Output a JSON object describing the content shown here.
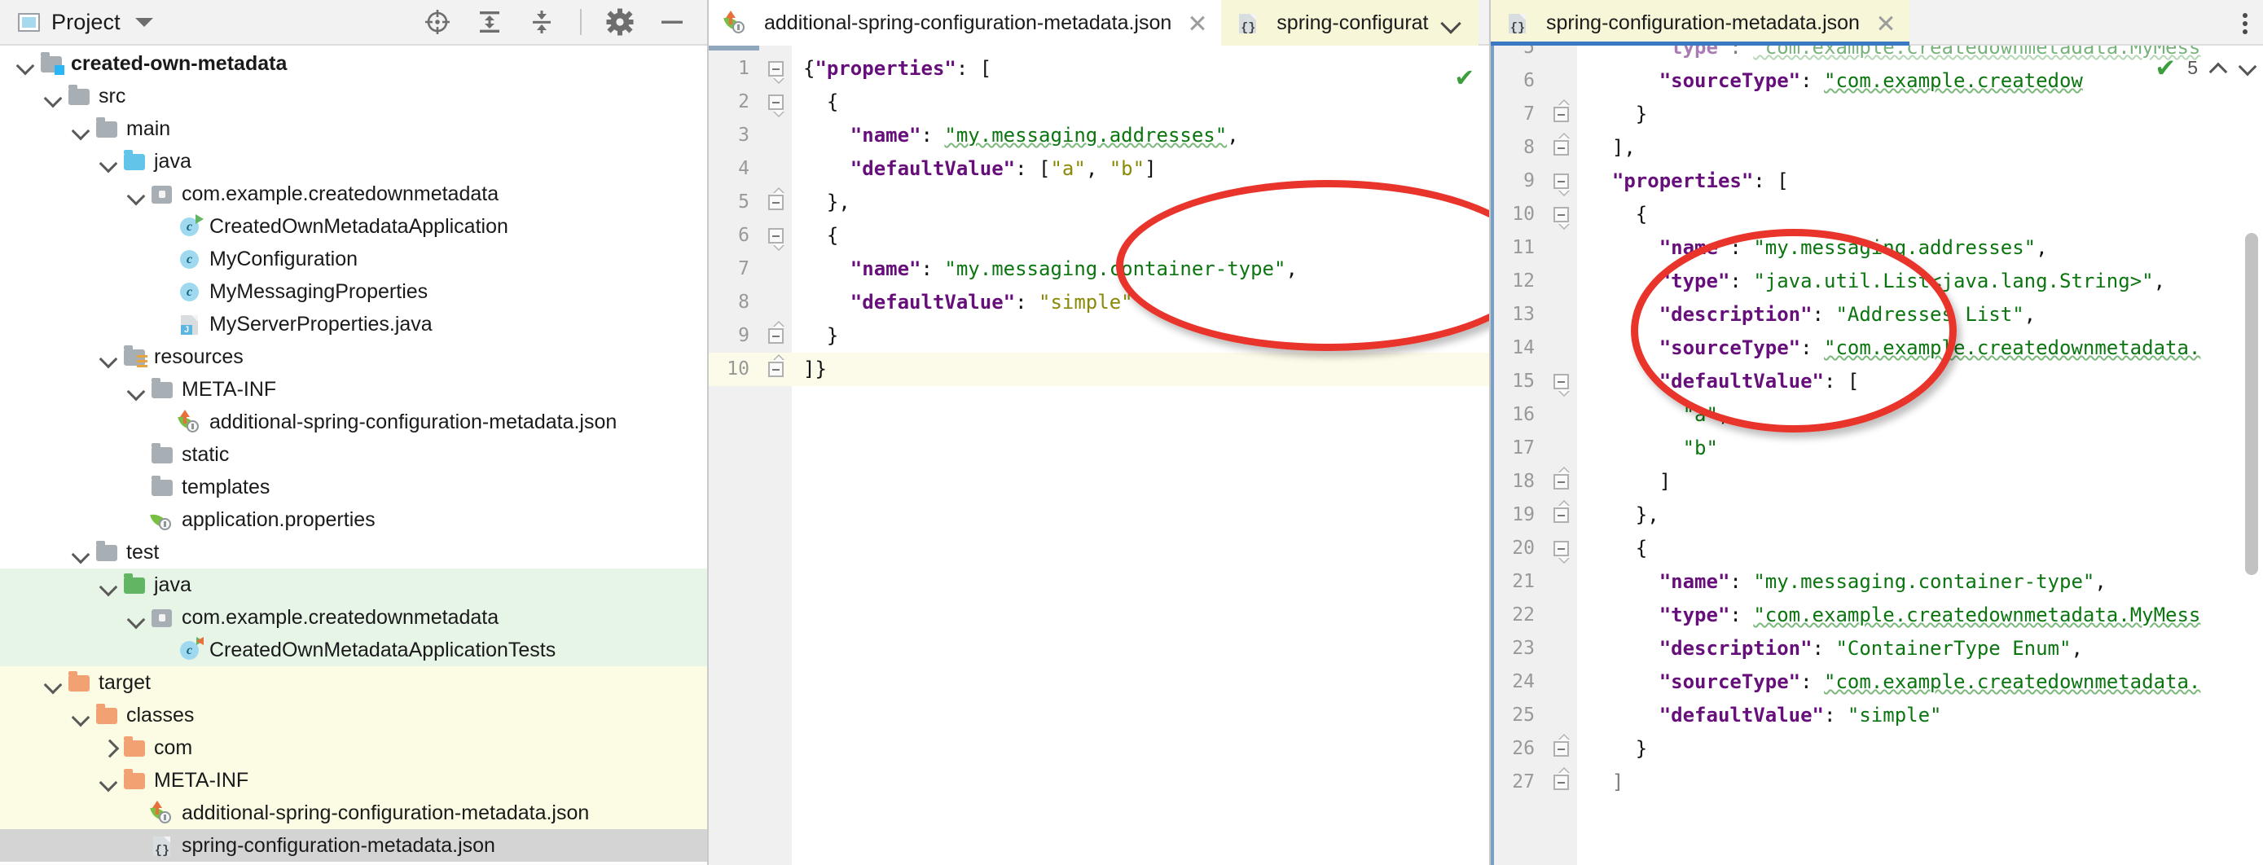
{
  "project_panel": {
    "title": "Project",
    "toolbar": [
      {
        "name": "select-opened-file-icon",
        "glyph": "target"
      },
      {
        "name": "expand-all-icon",
        "glyph": "expand"
      },
      {
        "name": "collapse-all-icon",
        "glyph": "collapse"
      },
      {
        "name": "settings-gear-icon",
        "glyph": "gear"
      },
      {
        "name": "hide-icon",
        "glyph": "minus"
      }
    ],
    "tree": [
      {
        "label": "created-own-metadata",
        "depth": 0,
        "arrow": "down",
        "icon": "module-folder",
        "bold": true,
        "bg": "none"
      },
      {
        "label": "src",
        "depth": 1,
        "arrow": "down",
        "icon": "folder-gray",
        "bold": false,
        "bg": "none"
      },
      {
        "label": "main",
        "depth": 2,
        "arrow": "down",
        "icon": "folder-gray",
        "bold": false,
        "bg": "none"
      },
      {
        "label": "java",
        "depth": 3,
        "arrow": "down",
        "icon": "folder-blue",
        "bold": false,
        "bg": "none"
      },
      {
        "label": "com.example.createdownmetadata",
        "depth": 4,
        "arrow": "down",
        "icon": "package",
        "bold": false,
        "bg": "none"
      },
      {
        "label": "CreatedOwnMetadataApplication",
        "depth": 5,
        "arrow": "none",
        "icon": "class-run",
        "bold": false,
        "bg": "none"
      },
      {
        "label": "MyConfiguration",
        "depth": 5,
        "arrow": "none",
        "icon": "class",
        "bold": false,
        "bg": "none"
      },
      {
        "label": "MyMessagingProperties",
        "depth": 5,
        "arrow": "none",
        "icon": "class",
        "bold": false,
        "bg": "none"
      },
      {
        "label": "MyServerProperties.java",
        "depth": 5,
        "arrow": "none",
        "icon": "java-file",
        "bold": false,
        "bg": "none"
      },
      {
        "label": "resources",
        "depth": 3,
        "arrow": "down",
        "icon": "folder-resources",
        "bold": false,
        "bg": "none"
      },
      {
        "label": "META-INF",
        "depth": 4,
        "arrow": "down",
        "icon": "folder-gray",
        "bold": false,
        "bg": "none"
      },
      {
        "label": "additional-spring-configuration-metadata.json",
        "depth": 5,
        "arrow": "none",
        "icon": "spring-additional",
        "bold": false,
        "bg": "none"
      },
      {
        "label": "static",
        "depth": 4,
        "arrow": "none",
        "icon": "folder-gray",
        "bold": false,
        "bg": "none"
      },
      {
        "label": "templates",
        "depth": 4,
        "arrow": "none",
        "icon": "folder-gray",
        "bold": false,
        "bg": "none"
      },
      {
        "label": "application.properties",
        "depth": 4,
        "arrow": "none",
        "icon": "spring-properties",
        "bold": false,
        "bg": "none"
      },
      {
        "label": "test",
        "depth": 2,
        "arrow": "down",
        "icon": "folder-gray",
        "bold": false,
        "bg": "none"
      },
      {
        "label": "java",
        "depth": 3,
        "arrow": "down",
        "icon": "folder-green",
        "bold": false,
        "bg": "green"
      },
      {
        "label": "com.example.createdownmetadata",
        "depth": 4,
        "arrow": "down",
        "icon": "package",
        "bold": false,
        "bg": "green"
      },
      {
        "label": "CreatedOwnMetadataApplicationTests",
        "depth": 5,
        "arrow": "none",
        "icon": "class-test",
        "bold": false,
        "bg": "green"
      },
      {
        "label": "target",
        "depth": 1,
        "arrow": "down",
        "icon": "folder-orange",
        "bold": false,
        "bg": "yellow"
      },
      {
        "label": "classes",
        "depth": 2,
        "arrow": "down",
        "icon": "folder-orange",
        "bold": false,
        "bg": "yellow"
      },
      {
        "label": "com",
        "depth": 3,
        "arrow": "right",
        "icon": "folder-orange",
        "bold": false,
        "bg": "yellow"
      },
      {
        "label": "META-INF",
        "depth": 3,
        "arrow": "down",
        "icon": "folder-orange",
        "bold": false,
        "bg": "yellow"
      },
      {
        "label": "additional-spring-configuration-metadata.json",
        "depth": 4,
        "arrow": "none",
        "icon": "spring-additional",
        "bold": false,
        "bg": "yellow"
      },
      {
        "label": "spring-configuration-metadata.json",
        "depth": 4,
        "arrow": "none",
        "icon": "json-file",
        "bold": false,
        "bg": "selected"
      }
    ]
  },
  "left_editor": {
    "tabs": [
      {
        "label": "additional-spring-configuration-metadata.json",
        "icon": "spring-additional",
        "state": "active-white",
        "closable": true
      },
      {
        "label": "spring-configurat",
        "icon": "json-file",
        "state": "spring-bg",
        "closable": false
      }
    ],
    "has_chevron": true,
    "has_kebab": true,
    "inspection_ok": "✔",
    "lines": [
      {
        "no": "1",
        "fold": "open",
        "current": false,
        "tokens": [
          {
            "t": "{",
            "c": "pun"
          },
          {
            "t": "\"properties\"",
            "c": "key"
          },
          {
            "t": ": [",
            "c": "pun"
          }
        ]
      },
      {
        "no": "2",
        "fold": "open",
        "current": false,
        "tokens": [
          {
            "t": "  {",
            "c": "pun"
          }
        ]
      },
      {
        "no": "3",
        "fold": "none",
        "current": false,
        "tokens": [
          {
            "t": "    ",
            "c": "pun"
          },
          {
            "t": "\"name\"",
            "c": "key"
          },
          {
            "t": ": ",
            "c": "pun"
          },
          {
            "t": "\"my.messaging.addresses\"",
            "c": "str-wavy"
          },
          {
            "t": ",",
            "c": "pun"
          }
        ]
      },
      {
        "no": "4",
        "fold": "none",
        "current": false,
        "tokens": [
          {
            "t": "    ",
            "c": "pun"
          },
          {
            "t": "\"defaultValue\"",
            "c": "key"
          },
          {
            "t": ": [",
            "c": "pun"
          },
          {
            "t": "\"a\"",
            "c": "arr"
          },
          {
            "t": ", ",
            "c": "pun"
          },
          {
            "t": "\"b\"",
            "c": "arr"
          },
          {
            "t": "]",
            "c": "pun"
          }
        ]
      },
      {
        "no": "5",
        "fold": "close",
        "current": false,
        "tokens": [
          {
            "t": "  },",
            "c": "pun"
          }
        ]
      },
      {
        "no": "6",
        "fold": "open",
        "current": false,
        "tokens": [
          {
            "t": "  {",
            "c": "pun"
          }
        ]
      },
      {
        "no": "7",
        "fold": "none",
        "current": false,
        "tokens": [
          {
            "t": "    ",
            "c": "pun"
          },
          {
            "t": "\"name\"",
            "c": "key"
          },
          {
            "t": ": ",
            "c": "pun"
          },
          {
            "t": "\"my.messaging.container-type\"",
            "c": "str"
          },
          {
            "t": ",",
            "c": "pun"
          }
        ]
      },
      {
        "no": "8",
        "fold": "none",
        "current": false,
        "tokens": [
          {
            "t": "    ",
            "c": "pun"
          },
          {
            "t": "\"defaultValue\"",
            "c": "key"
          },
          {
            "t": ": ",
            "c": "pun"
          },
          {
            "t": "\"simple\"",
            "c": "arr"
          }
        ]
      },
      {
        "no": "9",
        "fold": "close",
        "current": false,
        "tokens": [
          {
            "t": "  }",
            "c": "pun"
          }
        ]
      },
      {
        "no": "10",
        "fold": "close",
        "current": true,
        "tokens": [
          {
            "t": "]}",
            "c": "pun"
          }
        ]
      }
    ]
  },
  "right_editor": {
    "tabs": [
      {
        "label": "spring-configuration-metadata.json",
        "icon": "json-file",
        "state": "spring-bg-selected",
        "closable": true
      }
    ],
    "has_kebab": true,
    "inspection": {
      "check": "✔",
      "count": "5",
      "up": "∧",
      "down": "∨"
    },
    "lines": [
      {
        "no": "5",
        "fold": "none",
        "clipped": true,
        "tokens": [
          {
            "t": "      ",
            "c": "pun"
          },
          {
            "t": "\"type\"",
            "c": "key"
          },
          {
            "t": ": ",
            "c": "pun"
          },
          {
            "t": "\"com.example.createdownmetadata.MyMess",
            "c": "str-wavy"
          }
        ]
      },
      {
        "no": "6",
        "fold": "none",
        "clipped": false,
        "tokens": [
          {
            "t": "      ",
            "c": "pun"
          },
          {
            "t": "\"sourceType\"",
            "c": "key"
          },
          {
            "t": ": ",
            "c": "pun"
          },
          {
            "t": "\"com.example.createdow",
            "c": "str-wavy"
          }
        ]
      },
      {
        "no": "7",
        "fold": "close",
        "clipped": false,
        "tokens": [
          {
            "t": "    }",
            "c": "pun"
          }
        ]
      },
      {
        "no": "8",
        "fold": "close",
        "clipped": false,
        "tokens": [
          {
            "t": "  ],",
            "c": "pun"
          }
        ]
      },
      {
        "no": "9",
        "fold": "open",
        "clipped": false,
        "tokens": [
          {
            "t": "  ",
            "c": "pun"
          },
          {
            "t": "\"properties\"",
            "c": "key"
          },
          {
            "t": ": [",
            "c": "pun"
          }
        ]
      },
      {
        "no": "10",
        "fold": "open",
        "clipped": false,
        "tokens": [
          {
            "t": "    {",
            "c": "pun"
          }
        ]
      },
      {
        "no": "11",
        "fold": "none",
        "clipped": false,
        "tokens": [
          {
            "t": "      ",
            "c": "pun"
          },
          {
            "t": "\"name\"",
            "c": "key"
          },
          {
            "t": ": ",
            "c": "pun"
          },
          {
            "t": "\"my.messaging.addresses\"",
            "c": "str"
          },
          {
            "t": ",",
            "c": "pun"
          }
        ]
      },
      {
        "no": "12",
        "fold": "none",
        "clipped": false,
        "tokens": [
          {
            "t": "      ",
            "c": "pun"
          },
          {
            "t": "\"type\"",
            "c": "key"
          },
          {
            "t": ": ",
            "c": "pun"
          },
          {
            "t": "\"java.util.List<java.lang.String>\"",
            "c": "str"
          },
          {
            "t": ",",
            "c": "pun"
          }
        ]
      },
      {
        "no": "13",
        "fold": "none",
        "clipped": false,
        "tokens": [
          {
            "t": "      ",
            "c": "pun"
          },
          {
            "t": "\"description\"",
            "c": "key"
          },
          {
            "t": ": ",
            "c": "pun"
          },
          {
            "t": "\"Addresses List\"",
            "c": "str"
          },
          {
            "t": ",",
            "c": "pun"
          }
        ]
      },
      {
        "no": "14",
        "fold": "none",
        "clipped": false,
        "tokens": [
          {
            "t": "      ",
            "c": "pun"
          },
          {
            "t": "\"sourceType\"",
            "c": "key"
          },
          {
            "t": ": ",
            "c": "pun"
          },
          {
            "t": "\"com.example.createdownmetadata.",
            "c": "str-wavy"
          }
        ]
      },
      {
        "no": "15",
        "fold": "open",
        "clipped": false,
        "tokens": [
          {
            "t": "      ",
            "c": "pun"
          },
          {
            "t": "\"defaultValue\"",
            "c": "key"
          },
          {
            "t": ": [",
            "c": "pun"
          }
        ]
      },
      {
        "no": "16",
        "fold": "none",
        "clipped": false,
        "tokens": [
          {
            "t": "        ",
            "c": "pun"
          },
          {
            "t": "\"a\"",
            "c": "str"
          },
          {
            "t": ",",
            "c": "pun"
          }
        ]
      },
      {
        "no": "17",
        "fold": "none",
        "clipped": false,
        "tokens": [
          {
            "t": "        ",
            "c": "pun"
          },
          {
            "t": "\"b\"",
            "c": "str"
          }
        ]
      },
      {
        "no": "18",
        "fold": "close",
        "clipped": false,
        "tokens": [
          {
            "t": "      ]",
            "c": "pun"
          }
        ]
      },
      {
        "no": "19",
        "fold": "close",
        "clipped": false,
        "tokens": [
          {
            "t": "    },",
            "c": "pun"
          }
        ]
      },
      {
        "no": "20",
        "fold": "open",
        "clipped": false,
        "tokens": [
          {
            "t": "    {",
            "c": "pun"
          }
        ]
      },
      {
        "no": "21",
        "fold": "none",
        "clipped": false,
        "tokens": [
          {
            "t": "      ",
            "c": "pun"
          },
          {
            "t": "\"name\"",
            "c": "key"
          },
          {
            "t": ": ",
            "c": "pun"
          },
          {
            "t": "\"my.messaging.container-type\"",
            "c": "str"
          },
          {
            "t": ",",
            "c": "pun"
          }
        ]
      },
      {
        "no": "22",
        "fold": "none",
        "clipped": false,
        "tokens": [
          {
            "t": "      ",
            "c": "pun"
          },
          {
            "t": "\"type\"",
            "c": "key"
          },
          {
            "t": ": ",
            "c": "pun"
          },
          {
            "t": "\"com.example.createdownmetadata.MyMess",
            "c": "str-wavy"
          }
        ]
      },
      {
        "no": "23",
        "fold": "none",
        "clipped": false,
        "tokens": [
          {
            "t": "      ",
            "c": "pun"
          },
          {
            "t": "\"description\"",
            "c": "key"
          },
          {
            "t": ": ",
            "c": "pun"
          },
          {
            "t": "\"ContainerType Enum\"",
            "c": "str"
          },
          {
            "t": ",",
            "c": "pun"
          }
        ]
      },
      {
        "no": "24",
        "fold": "none",
        "clipped": false,
        "tokens": [
          {
            "t": "      ",
            "c": "pun"
          },
          {
            "t": "\"sourceType\"",
            "c": "key"
          },
          {
            "t": ": ",
            "c": "pun"
          },
          {
            "t": "\"com.example.createdownmetadata.",
            "c": "str-wavy"
          }
        ]
      },
      {
        "no": "25",
        "fold": "none",
        "clipped": false,
        "tokens": [
          {
            "t": "      ",
            "c": "pun"
          },
          {
            "t": "\"defaultValue\"",
            "c": "key"
          },
          {
            "t": ": ",
            "c": "pun"
          },
          {
            "t": "\"simple\"",
            "c": "str"
          }
        ]
      },
      {
        "no": "26",
        "fold": "close",
        "clipped": false,
        "tokens": [
          {
            "t": "    }",
            "c": "pun"
          }
        ]
      },
      {
        "no": "27",
        "fold": "close",
        "clipped": true,
        "tokens": [
          {
            "t": "  ]",
            "c": "pun"
          }
        ]
      }
    ]
  },
  "annotations": [
    {
      "name": "red-ellipse-left-editor"
    },
    {
      "name": "red-ellipse-right-editor"
    }
  ],
  "colors": {
    "json_key": "#660e7a",
    "json_string": "#0b7510",
    "json_array_value": "#8a8a08",
    "annotation_red": "#e8342a",
    "tab_active_underline": "#3b78c4",
    "test_source_bg": "#e7f5e7",
    "excluded_bg": "#fcfbe3",
    "selection_bg": "#d4d4d4",
    "current_line_bg": "#fcfae8"
  }
}
